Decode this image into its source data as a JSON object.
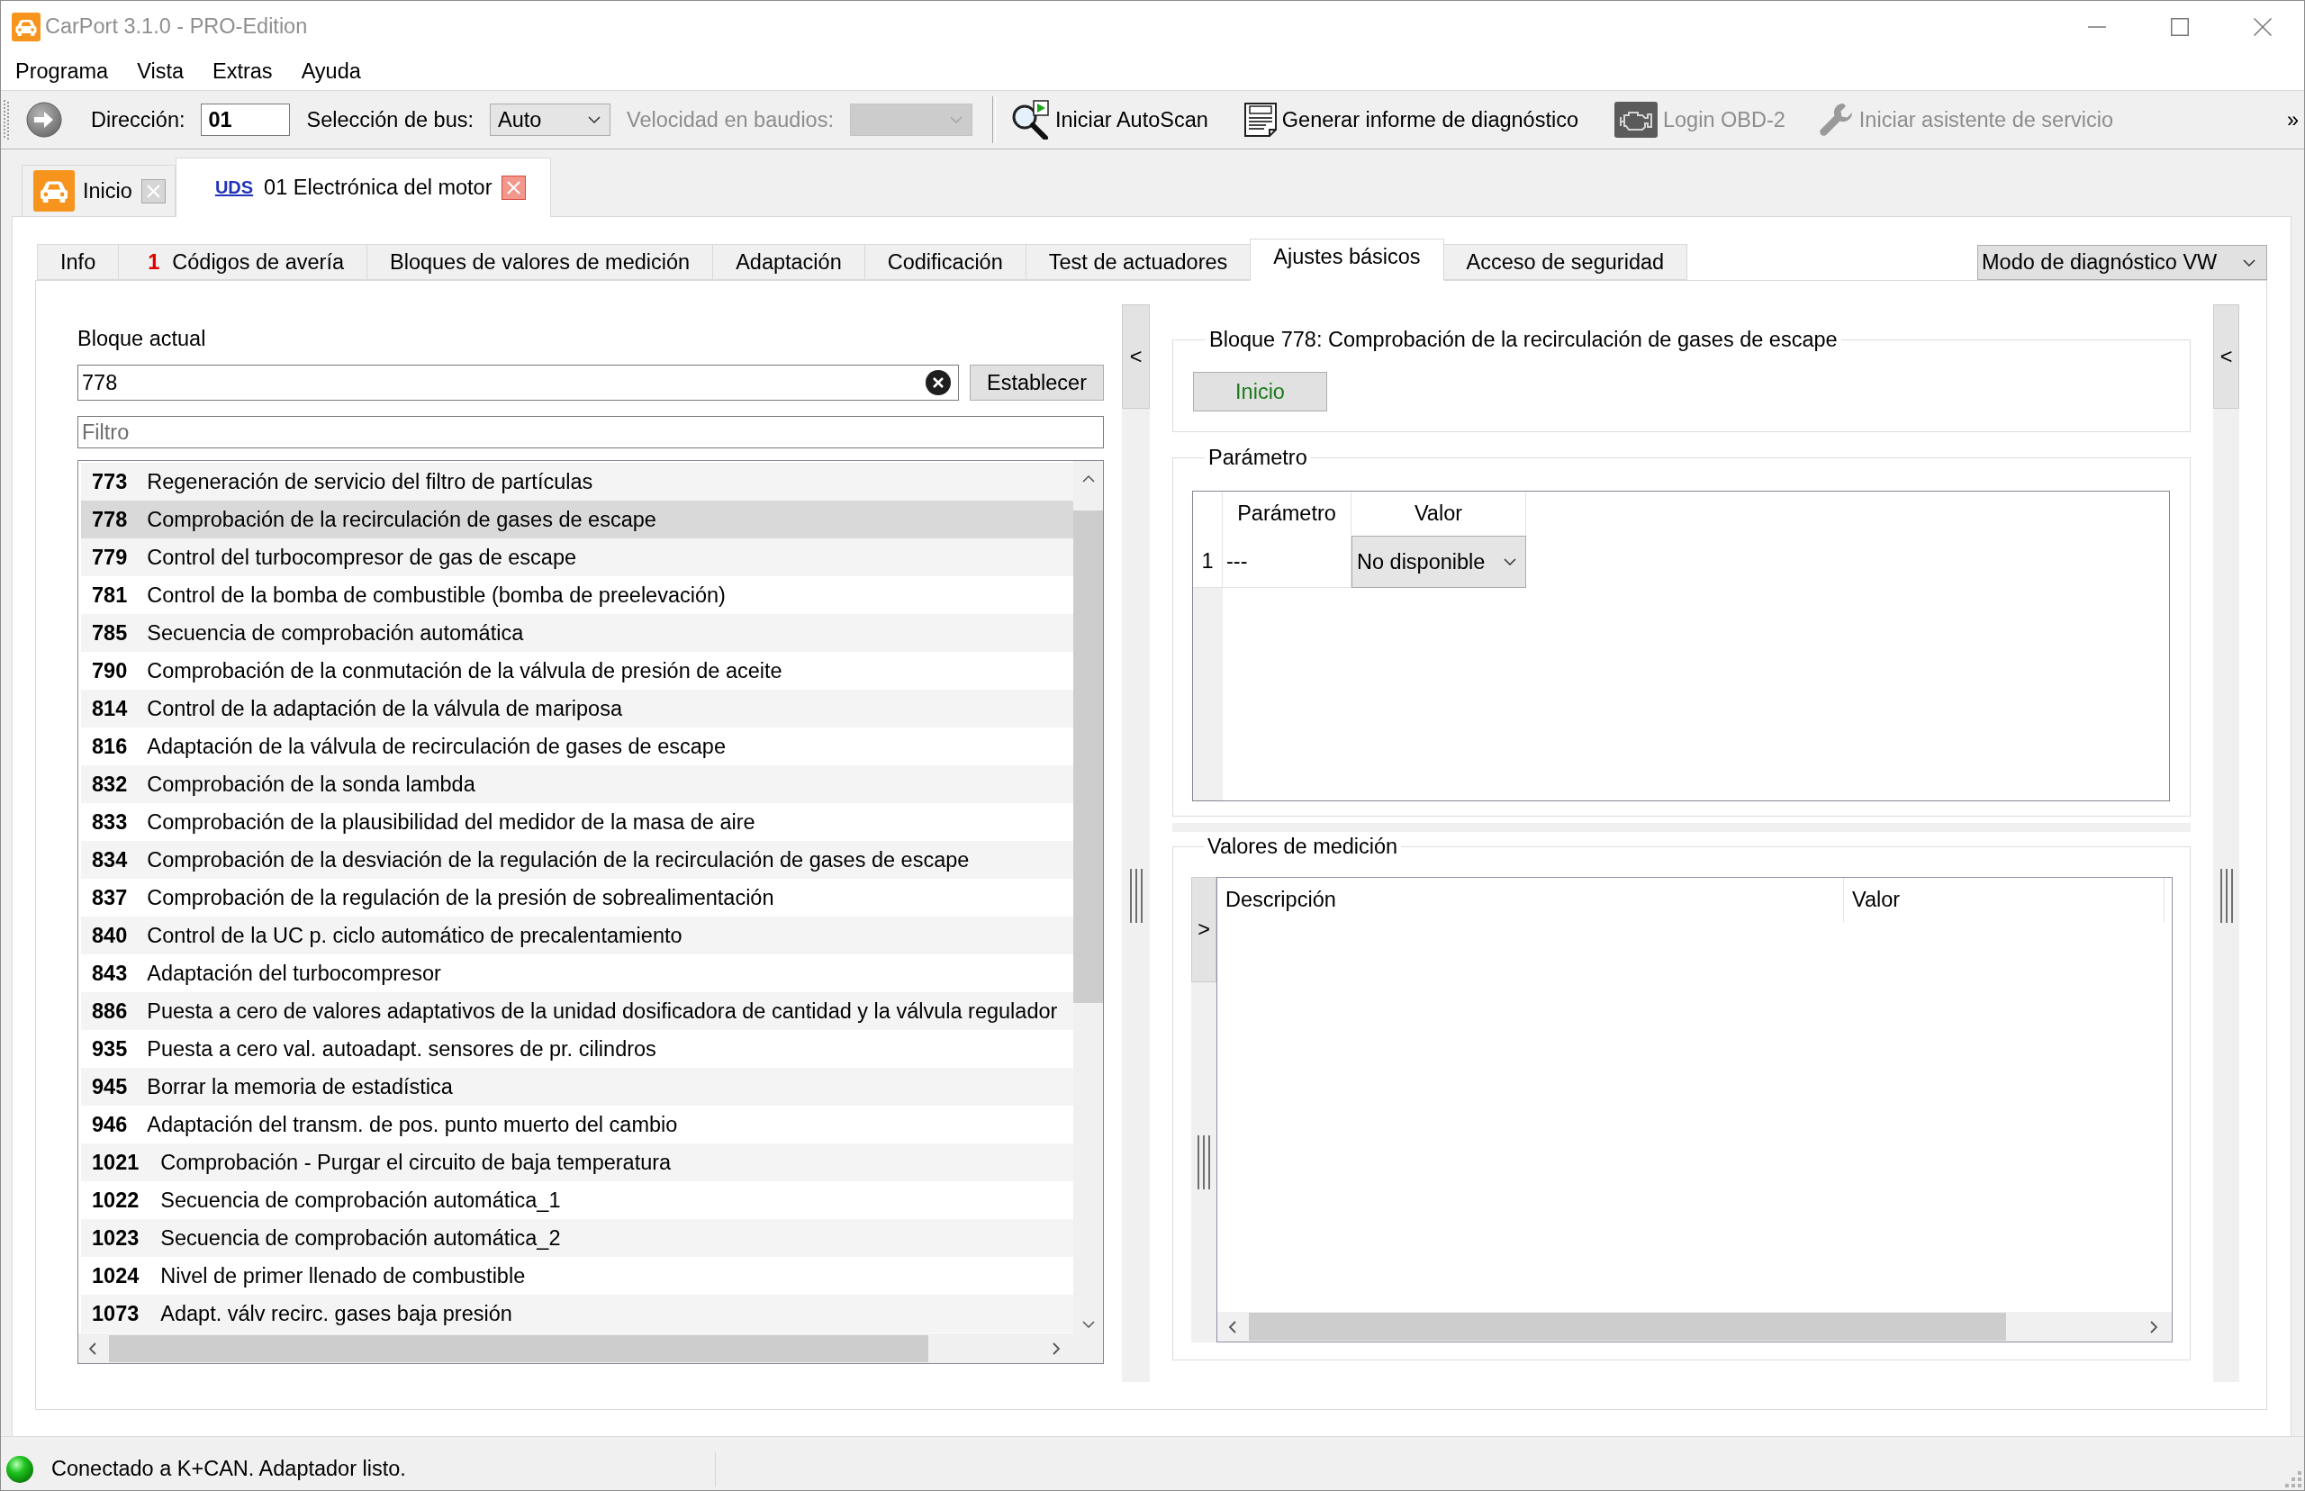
{
  "window": {
    "title": "CarPort 3.1.0 - PRO-Edition"
  },
  "menu": [
    "Programa",
    "Vista",
    "Extras",
    "Ayuda"
  ],
  "toolbar": {
    "address": {
      "label": "Dirección:",
      "value": "01"
    },
    "bus": {
      "label": "Selección de bus:",
      "value": "Auto"
    },
    "baud": {
      "label": "Velocidad en baudios:",
      "disabled": true
    },
    "actions": [
      {
        "kind": "autoscan",
        "label": "Iniciar AutoScan",
        "disabled": false
      },
      {
        "kind": "report",
        "label": "Generar informe de diagnóstico",
        "disabled": false
      },
      {
        "kind": "engine",
        "label": "Login OBD-2",
        "disabled": true
      },
      {
        "kind": "service",
        "label": "Iniciar asistente de servicio",
        "disabled": true
      }
    ],
    "overflow": "»"
  },
  "document_tabs": [
    {
      "kind": "home",
      "label": "Inicio",
      "selected": false
    },
    {
      "kind": "module",
      "badge": "UDS",
      "label": "01 Electrónica del motor",
      "selected": true
    }
  ],
  "module_tabs": [
    {
      "label": "Info",
      "selected": false
    },
    {
      "count": "1",
      "label": "Códigos de avería",
      "selected": false
    },
    {
      "label": "Bloques de valores de medición",
      "selected": false
    },
    {
      "label": "Adaptación",
      "selected": false
    },
    {
      "label": "Codificación",
      "selected": false
    },
    {
      "label": "Test de actuadores",
      "selected": false
    },
    {
      "label": "Ajustes básicos",
      "selected": true
    },
    {
      "label": "Acceso de seguridad",
      "selected": false
    }
  ],
  "mode_select": {
    "value": "Modo de diagnóstico VW"
  },
  "block_panel": {
    "label": "Bloque actual",
    "value": "778",
    "set_button": "Establecer",
    "filter": {
      "placeholder": "Filtro"
    },
    "blocks": [
      {
        "number": "773",
        "name": "Regeneración de servicio del filtro de partículas",
        "selected": false
      },
      {
        "number": "778",
        "name": "Comprobación de la recirculación de gases de escape",
        "selected": true
      },
      {
        "number": "779",
        "name": "Control del turbocompresor de gas de escape",
        "selected": false
      },
      {
        "number": "781",
        "name": "Control de la bomba de combustible (bomba de preelevación)",
        "selected": false
      },
      {
        "number": "785",
        "name": "Secuencia de comprobación automática",
        "selected": false
      },
      {
        "number": "790",
        "name": "Comprobación de la conmutación de la válvula de presión de aceite",
        "selected": false
      },
      {
        "number": "814",
        "name": "Control de la adaptación de la válvula de mariposa",
        "selected": false
      },
      {
        "number": "816",
        "name": "Adaptación de la válvula de recirculación de gases de escape",
        "selected": false
      },
      {
        "number": "832",
        "name": "Comprobación de la sonda lambda",
        "selected": false
      },
      {
        "number": "833",
        "name": "Comprobación de la plausibilidad del medidor de la masa de aire",
        "selected": false
      },
      {
        "number": "834",
        "name": "Comprobación de la desviación de la regulación de la recirculación de gases de escape",
        "selected": false
      },
      {
        "number": "837",
        "name": "Comprobación de la regulación de la presión de sobrealimentación",
        "selected": false
      },
      {
        "number": "840",
        "name": "Control de la UC p. ciclo automático de precalentamiento",
        "selected": false
      },
      {
        "number": "843",
        "name": "Adaptación del turbocompresor",
        "selected": false
      },
      {
        "number": "886",
        "name": "Puesta a cero de valores adaptativos de la unidad dosificadora de cantidad y la válvula regulador",
        "selected": false
      },
      {
        "number": "935",
        "name": "Puesta a cero val. autoadapt. sensores de pr. cilindros",
        "selected": false
      },
      {
        "number": "945",
        "name": "Borrar la memoria de estadística",
        "selected": false
      },
      {
        "number": "946",
        "name": "Adaptación del transm. de pos. punto muerto del cambio",
        "selected": false
      },
      {
        "number": "1021",
        "name": "Comprobación - Purgar el circuito de baja temperatura",
        "selected": false
      },
      {
        "number": "1022",
        "name": "Secuencia de comprobación automática_1",
        "selected": false
      },
      {
        "number": "1023",
        "name": "Secuencia de comprobación automática_2",
        "selected": false
      },
      {
        "number": "1024",
        "name": "Nivel de primer llenado de combustible",
        "selected": false
      },
      {
        "number": "1073",
        "name": "Adapt. válv recirc. gases baja presión",
        "selected": false
      }
    ]
  },
  "left_splitter": {
    "button": "<"
  },
  "basic_settings": {
    "title": "Bloque 778: Comprobación de la recirculación de gases de escape",
    "start_button": "Inicio",
    "parameter_group": {
      "title": "Parámetro",
      "columns": [
        "Parámetro",
        "Valor"
      ],
      "rows": [
        {
          "index": "1",
          "parameter": "---",
          "value": "No disponible"
        }
      ]
    },
    "measurement_group": {
      "title": "Valores de medición",
      "expand_button": ">",
      "columns": [
        "Descripción",
        "Valor"
      ]
    }
  },
  "right_splitter": {
    "button": "<"
  },
  "status_bar": {
    "connected": true,
    "text": "Conectado a K+CAN. Adaptador listo."
  }
}
